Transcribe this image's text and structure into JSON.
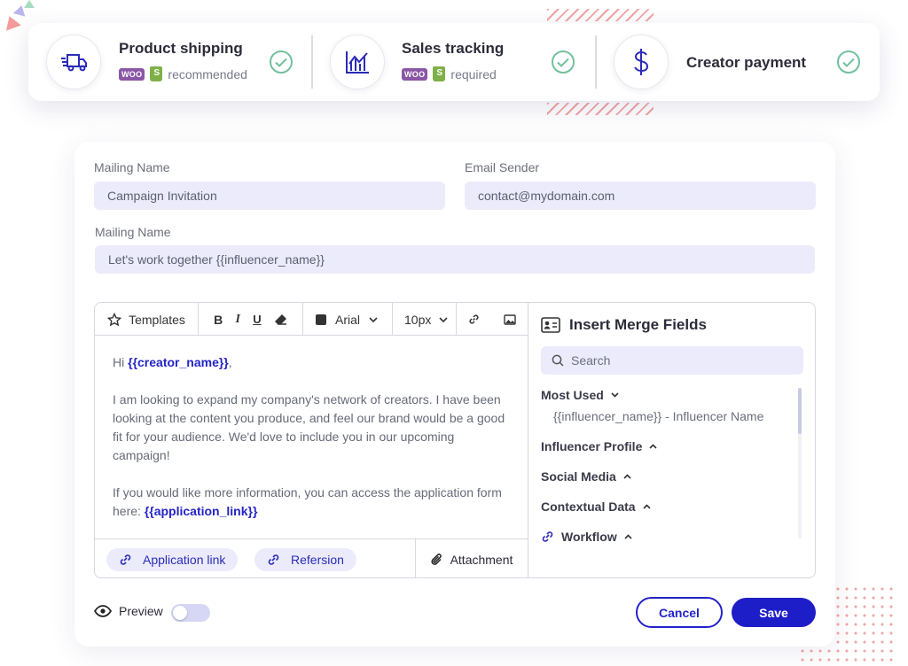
{
  "steps": [
    {
      "title": "Product shipping",
      "woo": "WOO",
      "note": "recommended",
      "icon": "truck-icon"
    },
    {
      "title": "Sales tracking",
      "woo": "WOO",
      "note": "required",
      "icon": "chart-icon"
    },
    {
      "title": "Creator payment",
      "icon": "dollar-icon"
    }
  ],
  "form": {
    "mailing_name_label": "Mailing Name",
    "mailing_name_value": "Campaign Invitation",
    "email_sender_label": "Email Sender",
    "email_sender_value": "contact@mydomain.com",
    "subject_label": "Mailing Name",
    "subject_value": "Let's work together {{influencer_name}}"
  },
  "toolbar": {
    "templates": "Templates",
    "bold": "B",
    "italic": "I",
    "underline": "U",
    "font": "Arial",
    "size": "10px"
  },
  "email_body": {
    "greeting": "Hi ",
    "greeting_tag": "{{creator_name}}",
    "greeting_end": ",",
    "para1": "I am looking to expand my company's network of creators. I have been looking at the content you produce, and feel our brand would be a good fit for your audience. We'd love to include you in our upcoming campaign!",
    "para2": "If you would like more information, you can access the application form here: ",
    "para2_tag": "{{application_link}}"
  },
  "bottom": {
    "chip1": "Application link",
    "chip2": "Refersion",
    "attachment": "Attachment"
  },
  "merge_panel": {
    "title": "Insert Merge Fields",
    "search_placeholder": "Search",
    "most_used": "Most Used",
    "most_used_item": "{{influencer_name}} - Influencer Name",
    "influencer_profile": "Influencer Profile",
    "social_media": "Social Media",
    "contextual_data": "Contextual Data",
    "workflow": "Workflow"
  },
  "footer": {
    "preview": "Preview",
    "cancel": "Cancel",
    "save": "Save"
  },
  "colors": {
    "accent": "#1e1ec8",
    "field_bg": "#ebebfb",
    "check": "#72c09d",
    "woo": "#8b56a6",
    "shopify": "#7fb048"
  }
}
